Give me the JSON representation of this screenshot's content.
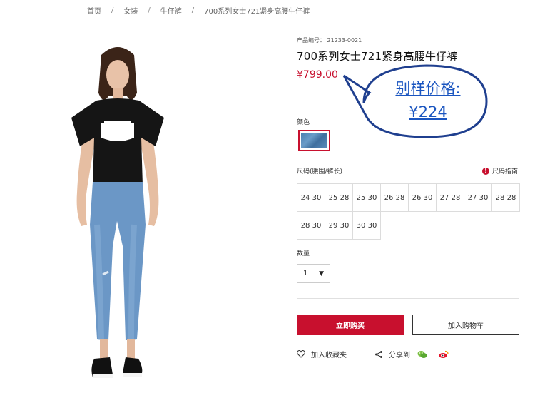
{
  "breadcrumb": {
    "items": [
      "首页",
      "女装",
      "牛仔裤",
      "700系列女士721紧身高腰牛仔裤"
    ],
    "separator": "/"
  },
  "product": {
    "sku": "产品编号： 21233-0021",
    "title": "700系列女士721紧身高腰牛仔裤",
    "price": "¥799.00"
  },
  "callout": {
    "line1": "别样价格:",
    "line2": "¥224"
  },
  "color": {
    "label": "颜色",
    "swatch_name": "light-blue-denim"
  },
  "size": {
    "label": "尺码(腰围/裤长)",
    "guide_label": "尺码指南",
    "options": [
      "24 30",
      "25 28",
      "25 30",
      "26 28",
      "26 30",
      "27 28",
      "27 30",
      "28 28",
      "28 30",
      "29 30",
      "30 30"
    ]
  },
  "quantity": {
    "label": "数量",
    "value": "1"
  },
  "actions": {
    "buy_now": "立即购买",
    "add_to_cart": "加入购物车",
    "add_favorite": "加入收藏夹",
    "share_to": "分享到"
  },
  "colors": {
    "accent": "#c8102e",
    "callout": "#1a55c0"
  }
}
